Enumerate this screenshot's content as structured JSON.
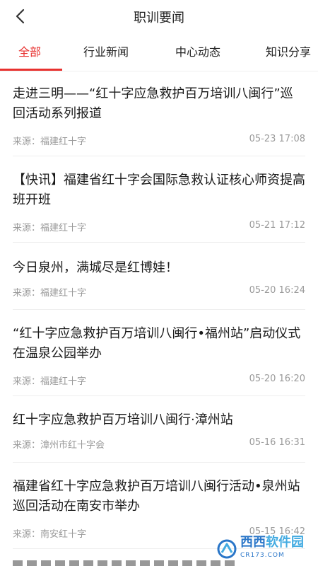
{
  "header": {
    "title": "职训要闻",
    "back_icon": "chevron-left-icon"
  },
  "tabs": [
    {
      "label": "全部",
      "active": true
    },
    {
      "label": "行业新闻",
      "active": false
    },
    {
      "label": "中心动态",
      "active": false
    },
    {
      "label": "知识分享",
      "active": false
    }
  ],
  "accent_color": "#e8312f",
  "news": [
    {
      "title": "走进三明——“红十字应急救护百万培训八闽行”巡回活动系列报道",
      "source": "来源：福建红十字",
      "time": "05-23 17:08"
    },
    {
      "title": "【快讯】福建省红十字会国际急救认证核心师资提高班开班",
      "source": "来源：福建红十字",
      "time": "05-21 17:12"
    },
    {
      "title": "今日泉州，满城尽是红博娃！",
      "source": "来源：福建红十字",
      "time": "05-20 16:24"
    },
    {
      "title": "“红十字应急救护百万培训八闽行•福州站”启动仪式在温泉公园举办",
      "source": "来源：福建红十字",
      "time": "05-20 16:20"
    },
    {
      "title": "红十字应急救护百万培训八闽行·漳州站",
      "source": "来源：漳州市红十字会",
      "time": "05-16 16:31"
    },
    {
      "title": "福建省红十字应急救护百万培训八闽行活动•泉州站巡回活动在南安市举办",
      "source": "来源：南安红十字",
      "time": "05-15 16:42"
    }
  ],
  "watermark": {
    "brand": "西西",
    "name": "软件园",
    "domain": "CR173.COM"
  }
}
